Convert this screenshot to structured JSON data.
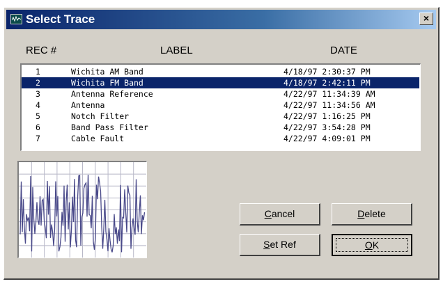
{
  "window": {
    "title": "Select Trace",
    "close_glyph": "×"
  },
  "columns": {
    "rec": "REC #",
    "label": "LABEL",
    "date": "DATE"
  },
  "records": [
    {
      "rec": "1",
      "label": "Wichita AM Band",
      "date": "4/18/97 2:30:37 PM"
    },
    {
      "rec": "2",
      "label": "Wichita FM Band",
      "date": "4/18/97 2:42:11 PM"
    },
    {
      "rec": "3",
      "label": "Antenna Reference",
      "date": "4/22/97 11:34:39 AM"
    },
    {
      "rec": "4",
      "label": "Antenna",
      "date": "4/22/97 11:34:56 AM"
    },
    {
      "rec": "5",
      "label": "Notch Filter",
      "date": "4/22/97 1:16:25 PM"
    },
    {
      "rec": "6",
      "label": "Band Pass Filter",
      "date": "4/22/97 3:54:28 PM"
    },
    {
      "rec": "7",
      "label": "Cable Fault",
      "date": "4/22/97 4:09:01 PM"
    }
  ],
  "selected_index": 1,
  "buttons": {
    "cancel": {
      "mnemonic": "C",
      "rest": "ancel"
    },
    "delete": {
      "mnemonic": "D",
      "rest": "elete"
    },
    "set_ref": {
      "mnemonic": "S",
      "rest": "et Ref"
    },
    "ok": {
      "mnemonic": "O",
      "rest": "K"
    }
  },
  "icons": {
    "app": "trace-icon",
    "close": "close-icon"
  },
  "colors": {
    "selection": "#0a246a",
    "trace": "#4a4a8a",
    "grid": "#b8b8c8"
  }
}
